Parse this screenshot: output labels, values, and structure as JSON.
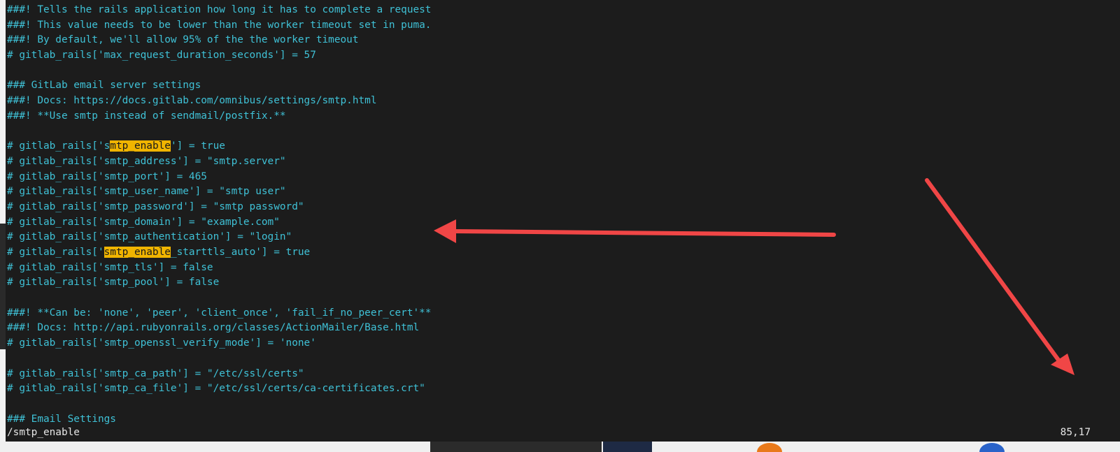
{
  "editor": {
    "lines": [
      {
        "parts": [
          "###! Tells the rails application how long it has to complete a request"
        ]
      },
      {
        "parts": [
          "###! This value needs to be lower than the worker timeout set in puma."
        ]
      },
      {
        "parts": [
          "###! By default, we'll allow 95% of the the worker timeout"
        ]
      },
      {
        "parts": [
          "# gitlab_rails['max_request_duration_seconds'] = 57"
        ]
      },
      {
        "parts": [
          ""
        ]
      },
      {
        "parts": [
          "### GitLab email server settings"
        ]
      },
      {
        "parts": [
          "###! Docs: https://docs.gitlab.com/omnibus/settings/smtp.html"
        ]
      },
      {
        "parts": [
          "###! **Use smtp instead of sendmail/postfix.**"
        ]
      },
      {
        "parts": [
          ""
        ]
      },
      {
        "parts": [
          "# gitlab_rails['s",
          "mtp_enable",
          "'] = true"
        ],
        "hl": 1
      },
      {
        "parts": [
          "# gitlab_rails['smtp_address'] = \"smtp.server\""
        ]
      },
      {
        "parts": [
          "# gitlab_rails['smtp_port'] = 465"
        ]
      },
      {
        "parts": [
          "# gitlab_rails['smtp_user_name'] = \"smtp user\""
        ]
      },
      {
        "parts": [
          "# gitlab_rails['smtp_password'] = \"smtp password\""
        ]
      },
      {
        "parts": [
          "# gitlab_rails['smtp_domain'] = \"example.com\""
        ]
      },
      {
        "parts": [
          "# gitlab_rails['smtp_authentication'] = \"login\""
        ]
      },
      {
        "parts": [
          "# gitlab_rails['",
          "smtp_enable",
          "_starttls_auto'] = true"
        ],
        "hl": 1
      },
      {
        "parts": [
          "# gitlab_rails['smtp_tls'] = false"
        ]
      },
      {
        "parts": [
          "# gitlab_rails['smtp_pool'] = false"
        ]
      },
      {
        "parts": [
          ""
        ]
      },
      {
        "parts": [
          "###! **Can be: 'none', 'peer', 'client_once', 'fail_if_no_peer_cert'**"
        ]
      },
      {
        "parts": [
          "###! Docs: http://api.rubyonrails.org/classes/ActionMailer/Base.html"
        ]
      },
      {
        "parts": [
          "# gitlab_rails['smtp_openssl_verify_mode'] = 'none'"
        ]
      },
      {
        "parts": [
          ""
        ]
      },
      {
        "parts": [
          "# gitlab_rails['smtp_ca_path'] = \"/etc/ssl/certs\""
        ]
      },
      {
        "parts": [
          "# gitlab_rails['smtp_ca_file'] = \"/etc/ssl/certs/ca-certificates.crt\""
        ]
      },
      {
        "parts": [
          ""
        ]
      },
      {
        "parts": [
          "### Email Settings"
        ]
      }
    ],
    "command_line": "/smtp_enable",
    "cursor_position": "85,17"
  },
  "colors": {
    "background": "#1c1c1c",
    "comment_text": "#3fc1d6",
    "search_highlight": "#f0b400",
    "annotation_arrow": "#f04646"
  },
  "annotations": [
    {
      "type": "arrow",
      "direction": "left",
      "color": "#f04646"
    },
    {
      "type": "arrow",
      "direction": "down-right",
      "color": "#f04646"
    }
  ]
}
